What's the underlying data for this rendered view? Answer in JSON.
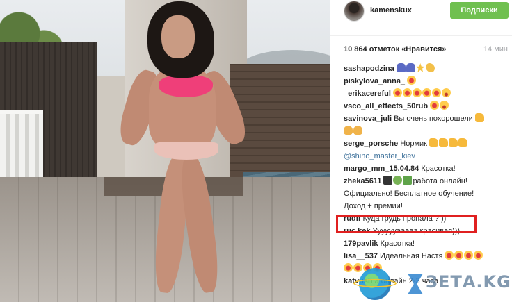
{
  "header": {
    "username": "kamenskux",
    "follow_label": "Подписки"
  },
  "post": {
    "likes": "10 864 отметок «Нравится»",
    "time": "14 мин"
  },
  "comments": [
    {
      "user": "sashapodzina",
      "text": "",
      "emoji": [
        "e-family",
        "e-family",
        "e-star",
        "e-clap"
      ]
    },
    {
      "user": "piskylova_anna_",
      "text": "",
      "emoji": [
        "e-heart"
      ]
    },
    {
      "user": "_erikacereful",
      "text": "",
      "emoji": [
        "e-heart",
        "e-heart",
        "e-heart",
        "e-heart",
        "e-heart",
        "e-worried"
      ]
    },
    {
      "user": "vsco_all_effects_50rub",
      "text": "",
      "emoji": [
        "e-heart",
        "e-worried"
      ]
    },
    {
      "user": "savinova_juli",
      "text": "Вы очень похорошели",
      "emoji": [
        "e-thumb"
      ]
    },
    {
      "user": "",
      "text": "",
      "emoji": [
        "e-hands",
        "e-hands"
      ]
    },
    {
      "user": "serge_porsche",
      "text": "Нормик",
      "emoji": [
        "e-thumb",
        "e-thumb",
        "e-thumb",
        "e-thumb"
      ]
    },
    {
      "user": "",
      "text": "@shino_master_kiev",
      "mention": true,
      "emoji": []
    },
    {
      "user": "margo_mm_15.04.84",
      "text": "Красотка!",
      "emoji": []
    },
    {
      "user": "zheka5611",
      "text": "работа онлайн!",
      "emoji": [
        "e-cap",
        "e-apple",
        "e-house"
      ]
    },
    {
      "user": "",
      "text": "Официально! Бесплатное обучение!",
      "emoji": []
    },
    {
      "user": "",
      "text": "Доход + премии!",
      "emoji": []
    },
    {
      "user": "rudlf",
      "text": "Куда грудь пропала ? ))",
      "emoji": []
    },
    {
      "user": "ruc.kek",
      "text": "Ууууууааааа красивая)))",
      "emoji": []
    },
    {
      "user": "179pavlik",
      "text": "Красотка!",
      "emoji": []
    },
    {
      "user": "lisa__537",
      "text": "Идеальная Настя",
      "emoji": [
        "e-heart",
        "e-heart",
        "e-heart",
        "e-heart"
      ]
    },
    {
      "user": "",
      "text": "",
      "emoji": [
        "e-heart",
        "e-heart",
        "e-heart",
        "e-heart"
      ]
    },
    {
      "user": "katvush",
      "text": "а онлайн 2-3 часа",
      "emoji": []
    }
  ],
  "watermark": {
    "text": "ЗЕТА.KG"
  },
  "colors": {
    "follow_button": "#70c050",
    "highlight": "#e02020",
    "mention": "#3f729b"
  }
}
